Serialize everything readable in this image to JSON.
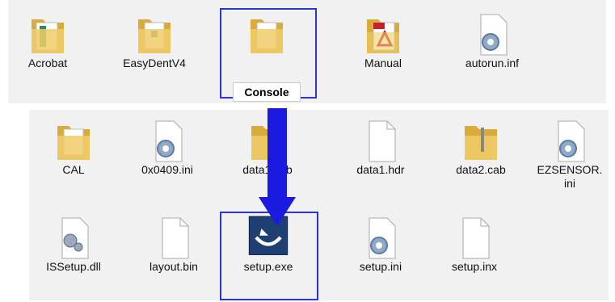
{
  "top_row": [
    {
      "label": "Acrobat",
      "icon": "folder-acrobat-icon"
    },
    {
      "label": "EasyDentV4",
      "icon": "folder-app-icon"
    },
    {
      "label": "Console",
      "icon": "folder-icon"
    },
    {
      "label": "Manual",
      "icon": "folder-pdf-icon"
    },
    {
      "label": "autorun.inf",
      "icon": "settings-file-icon"
    }
  ],
  "mid_row": [
    {
      "label": "CAL",
      "icon": "folder-icon"
    },
    {
      "label": "0x0409.ini",
      "icon": "settings-file-icon"
    },
    {
      "label": "data1.cab",
      "icon": "cabinet-folder-icon"
    },
    {
      "label": "data1.hdr",
      "icon": "blank-file-icon"
    },
    {
      "label": "data2.cab",
      "icon": "zip-folder-icon"
    },
    {
      "label": "EZSENSOR.\nini",
      "icon": "settings-file-icon"
    }
  ],
  "bottom_row": [
    {
      "label": "ISSetup.dll",
      "icon": "dll-file-icon"
    },
    {
      "label": "layout.bin",
      "icon": "blank-file-icon"
    },
    {
      "label": "setup.exe",
      "icon": "setup-exe-icon"
    },
    {
      "label": "setup.ini",
      "icon": "settings-file-icon"
    },
    {
      "label": "setup.inx",
      "icon": "blank-file-icon"
    }
  ],
  "colors": {
    "highlight": "#2a35d6",
    "arrow": "#1a1ae0",
    "folder": "#e9c35a"
  }
}
